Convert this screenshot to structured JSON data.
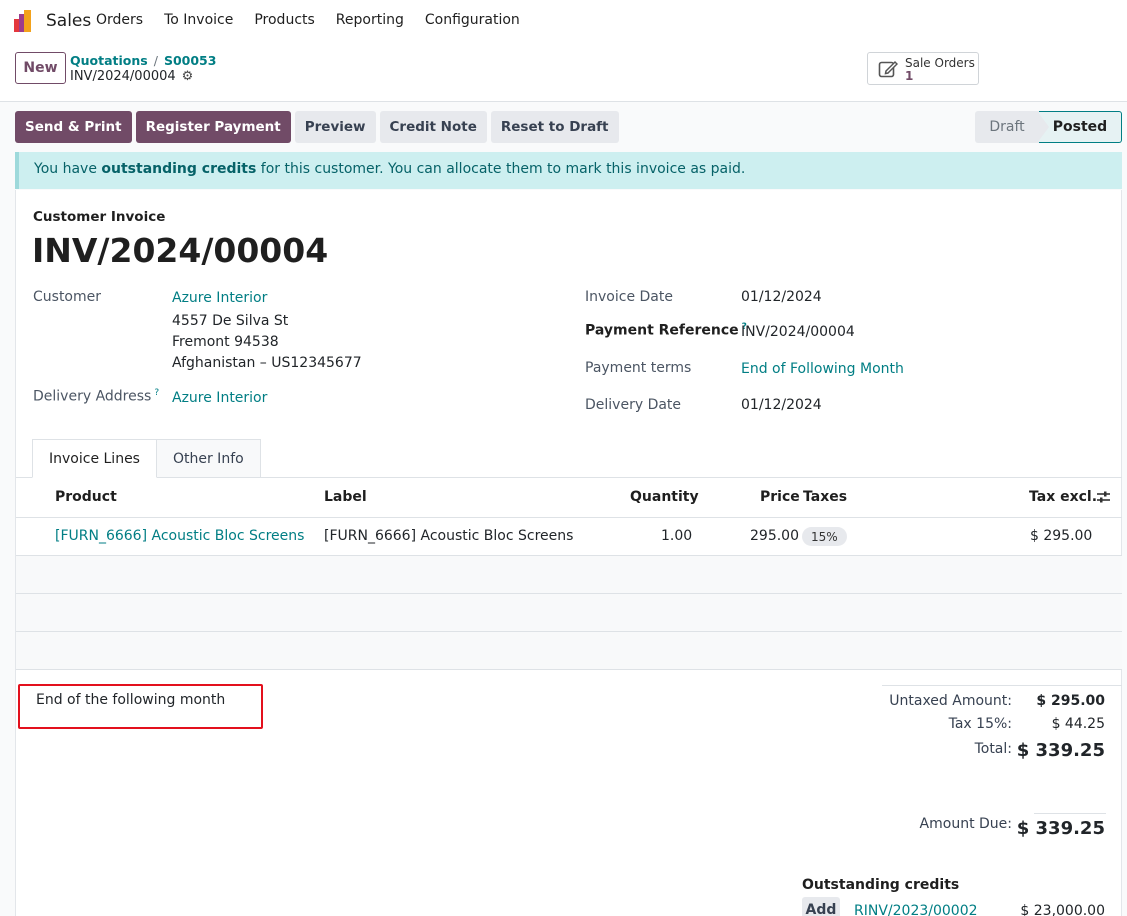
{
  "app": {
    "name": "Sales",
    "menu": [
      "Orders",
      "To Invoice",
      "Products",
      "Reporting",
      "Configuration"
    ],
    "brand_color": "#714b67",
    "link_color": "#017e84"
  },
  "control": {
    "new_label": "New",
    "breadcrumb": [
      "Quotations",
      "S00053"
    ],
    "current": "INV/2024/00004",
    "smart_button": {
      "label": "Sale Orders",
      "count": "1"
    }
  },
  "actions": {
    "send_print": "Send & Print",
    "register_payment": "Register Payment",
    "preview": "Preview",
    "credit_note": "Credit Note",
    "reset_draft": "Reset to Draft"
  },
  "status": {
    "draft": "Draft",
    "posted": "Posted"
  },
  "alert": {
    "pre": "You have ",
    "bold": "outstanding credits",
    "post": " for this customer. You can allocate them to mark this invoice as paid."
  },
  "invoice": {
    "type": "Customer Invoice",
    "number": "INV/2024/00004",
    "customer_label": "Customer",
    "customer_name": "Azure Interior",
    "address_lines": [
      "4557 De Silva St",
      "Fremont 94538",
      "Afghanistan – US12345677"
    ],
    "delivery_address_label": "Delivery Address",
    "delivery_address": "Azure Interior",
    "invoice_date_label": "Invoice Date",
    "invoice_date": "01/12/2024",
    "payment_ref_label": "Payment Reference",
    "payment_ref": "INV/2024/00004",
    "payment_terms_label": "Payment terms",
    "payment_terms": "End of Following Month",
    "delivery_date_label": "Delivery Date",
    "delivery_date": "01/12/2024",
    "help_mark": "?"
  },
  "tabs": [
    "Invoice Lines",
    "Other Info"
  ],
  "lines": {
    "headers": {
      "product": "Product",
      "label": "Label",
      "quantity": "Quantity",
      "price": "Price",
      "taxes": "Taxes",
      "tax_excl": "Tax excl."
    },
    "rows": [
      {
        "product": "[FURN_6666] Acoustic Bloc Screens",
        "label": "[FURN_6666] Acoustic Bloc Screens",
        "quantity": "1.00",
        "price": "295.00",
        "tax": "15%",
        "subtotal": "$ 295.00"
      }
    ]
  },
  "terms_note": "End of the following month",
  "totals": {
    "untaxed_label": "Untaxed Amount:",
    "untaxed": "$ 295.00",
    "tax_label": "Tax 15%:",
    "tax": "$ 44.25",
    "total_label": "Total:",
    "total": "$ 339.25",
    "due_label": "Amount Due:",
    "due": "$ 339.25"
  },
  "outstanding": {
    "title": "Outstanding credits",
    "add_label": "Add",
    "ref": "RINV/2023/00002",
    "amount": "$ 23,000.00"
  }
}
